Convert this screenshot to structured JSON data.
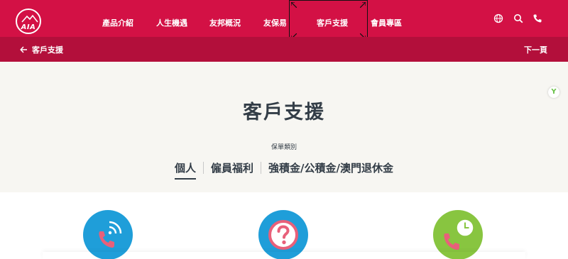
{
  "brand": {
    "logo_text": "AIA",
    "primary_color": "#d31145",
    "subbar_color": "#b30f3b"
  },
  "topnav": {
    "items": [
      {
        "label": "產品介紹"
      },
      {
        "label": "人生機遇"
      },
      {
        "label": "友邦概況"
      },
      {
        "label": "友保易"
      },
      {
        "label": "客戶支援"
      },
      {
        "label": "會員專區"
      }
    ],
    "active_index": 4,
    "icons": [
      "globe-icon",
      "search-icon",
      "phone-icon"
    ]
  },
  "subbar": {
    "back_label": "客戶支援",
    "next_label": "下一頁"
  },
  "hero": {
    "title": "客戶支援",
    "category_label": "保單類別",
    "tabs": [
      {
        "label": "個人",
        "active": true
      },
      {
        "label": "僱員福利",
        "active": false
      },
      {
        "label": "強積金/公積金/澳門退休金",
        "active": false
      }
    ],
    "side_badge": "Y"
  },
  "cards": [
    {
      "icon": "phone-call-icon",
      "color": "#1f9ed9"
    },
    {
      "icon": "question-icon",
      "color": "#1f9ed9"
    },
    {
      "icon": "phone-hours-icon",
      "color": "#88c540"
    }
  ]
}
